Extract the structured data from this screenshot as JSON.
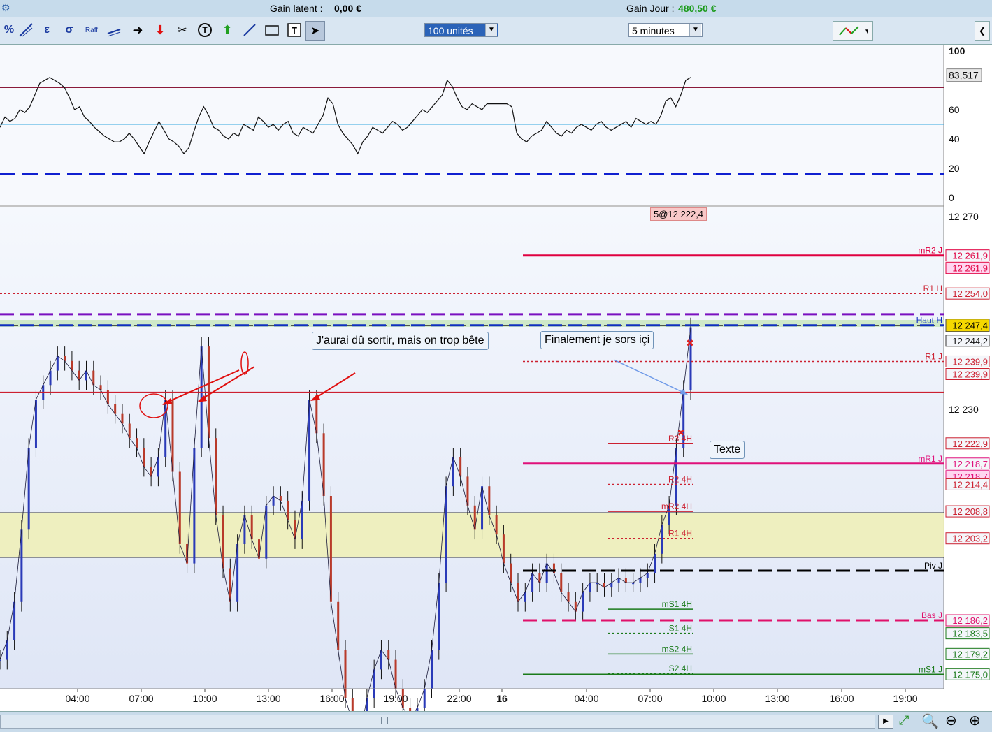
{
  "topbar": {
    "gain_latent_label": "Gain latent :",
    "gain_latent_value": "0,00 €",
    "gain_jour_label": "Gain Jour :",
    "gain_jour_value": "480,50 €",
    "gain_jour_color": "#1a9a1a"
  },
  "toolbar": {
    "quantity_select": "100 unités",
    "timeframe_select": "5 minutes",
    "tools": [
      "percent-icon",
      "trendline-icon",
      "epsilon-icon",
      "sigma-icon",
      "raff-icon",
      "channel-icon",
      "arrow-right-icon",
      "arrow-down-red-icon",
      "ruler-icon",
      "text-circle-icon",
      "arrow-up-green-icon",
      "diagonal-icon",
      "rectangle-icon",
      "text-box-icon",
      "cursor-icon"
    ],
    "raff_label": "Raff"
  },
  "annotations": {
    "mistake": "J'aurai dû sortir, mais on trop bête",
    "exit": "Finalement je sors içi",
    "texte": "Texte",
    "order_tag": "5@12 222,4"
  },
  "chart_data": [
    {
      "type": "line",
      "panel": "oscillator",
      "ylim": [
        0,
        100
      ],
      "yticks": [
        "100",
        "60",
        "40",
        "20",
        "0"
      ],
      "current_value": "83,517",
      "levels": [
        {
          "value": 75,
          "color": "#8a1a3a"
        },
        {
          "value": 50,
          "color": "#33a8e0"
        },
        {
          "value": 25,
          "color": "#cc3355"
        },
        {
          "value": 16,
          "color": "#1020d0",
          "style": "dashed"
        }
      ],
      "values": [
        48,
        55,
        52,
        54,
        60,
        58,
        62,
        70,
        78,
        80,
        82,
        80,
        78,
        75,
        68,
        60,
        62,
        55,
        52,
        48,
        45,
        42,
        40,
        38,
        38,
        40,
        44,
        40,
        35,
        30,
        38,
        45,
        52,
        46,
        40,
        38,
        35,
        30,
        34,
        45,
        55,
        62,
        56,
        48,
        46,
        42,
        40,
        44,
        42,
        50,
        48,
        46,
        55,
        52,
        48,
        50,
        46,
        50,
        52,
        44,
        42,
        48,
        46,
        44,
        50,
        56,
        68,
        64,
        50,
        44,
        40,
        36,
        30,
        38,
        42,
        48,
        46,
        44,
        48,
        52,
        50,
        46,
        48,
        52,
        56,
        60,
        58,
        62,
        66,
        70,
        80,
        76,
        68,
        62,
        60,
        64,
        62,
        60,
        64,
        64,
        64,
        64,
        64,
        62,
        44,
        40,
        38,
        42,
        44,
        46,
        52,
        48,
        44,
        42,
        46,
        44,
        48,
        50,
        48,
        46,
        50,
        52,
        48,
        46,
        48,
        50,
        52,
        48,
        54,
        52,
        50,
        52,
        50,
        56,
        66,
        68,
        62,
        70,
        80,
        82
      ]
    },
    {
      "type": "line",
      "panel": "price",
      "ylim": [
        12172,
        12272
      ],
      "yticks": [
        "12 270",
        "12 230"
      ],
      "xticks": [
        "04:00",
        "07:00",
        "10:00",
        "13:00",
        "16:00",
        "19:00",
        "22:00",
        "16",
        "04:00",
        "07:00",
        "10:00",
        "13:00",
        "16:00",
        "19:00"
      ],
      "values": [
        12178,
        12182,
        12190,
        12205,
        12222,
        12232,
        12235,
        12238,
        12241,
        12240,
        12238,
        12236,
        12238,
        12235,
        12234,
        12231,
        12229,
        12227,
        12224,
        12222,
        12218,
        12216,
        12220,
        12232,
        12217,
        12202,
        12198,
        12222,
        12243,
        12224,
        12208,
        12197,
        12190,
        12202,
        12208,
        12203,
        12199,
        12210,
        12212,
        12211,
        12207,
        12203,
        12211,
        12232,
        12225,
        12212,
        12190,
        12180,
        12170,
        12165,
        12162,
        12170,
        12176,
        12180,
        12178,
        12172,
        12168,
        12166,
        12168,
        12172,
        12180,
        12194,
        12214,
        12220,
        12216,
        12210,
        12205,
        12214,
        12208,
        12204,
        12198,
        12194,
        12190,
        12192,
        12196,
        12194,
        12198,
        12196,
        12192,
        12190,
        12188,
        12192,
        12194,
        12194,
        12193,
        12194,
        12195,
        12194,
        12194,
        12195,
        12196,
        12200,
        12206,
        12210,
        12222,
        12234,
        12247
      ],
      "hlines": [
        {
          "label": "mR2 J",
          "price": "12 261,9",
          "value": 12261.9,
          "color": "#e00040",
          "style": "solid",
          "start": "right-half",
          "extra_tag": "12 261,9",
          "extra_color": "#ffd6f0"
        },
        {
          "label": "R1 H",
          "price": "12 254,0",
          "value": 12254.0,
          "color": "#cc2030",
          "style": "dotted"
        },
        {
          "label": "",
          "price": "",
          "value": 12249.7,
          "color": "#7a10c0",
          "style": "dashed"
        },
        {
          "label": "Haut H",
          "price": "12 247,4",
          "value": 12247.4,
          "color": "#1030c0",
          "style": "dashed"
        },
        {
          "label": "R1 J",
          "price": "12 239,9",
          "value": 12239.9,
          "color": "#cc2030",
          "style": "dotted",
          "start": "right-half",
          "extra_tag": "12 239,9"
        },
        {
          "label": "",
          "price": "",
          "value": 12233.5,
          "color": "#cc2030",
          "style": "solid"
        },
        {
          "label": "R3 4H",
          "price": "12 222,9",
          "value": 12222.9,
          "color": "#cc2030",
          "style": "solid",
          "start": "4h"
        },
        {
          "label": "mR1 J",
          "price": "12 218,7",
          "value": 12218.7,
          "color": "#e0107a",
          "style": "solid",
          "start": "right-half",
          "extra_tag": "12 218,7",
          "extra_color": "#ffd6f0"
        },
        {
          "label": "R2 4H",
          "price": "12 214,4",
          "value": 12214.4,
          "color": "#cc2030",
          "style": "dotted",
          "start": "4h"
        },
        {
          "label": "mR2 4H",
          "price": "12 208,8",
          "value": 12208.8,
          "color": "#cc2030",
          "style": "solid",
          "start": "4h"
        },
        {
          "label": "R1 4H",
          "price": "12 203,2",
          "value": 12203.2,
          "color": "#cc2030",
          "style": "dotted",
          "start": "4h"
        },
        {
          "label": "Piv J",
          "price": "",
          "value": 12196.5,
          "color": "#000000",
          "style": "dashed",
          "start": "right-half"
        },
        {
          "label": "mS1 4H",
          "price": "",
          "value": 12188.5,
          "color": "#1a7a1a",
          "style": "solid",
          "start": "4h"
        },
        {
          "label": "Bas J",
          "price": "12 186,2",
          "value": 12186.2,
          "color": "#e0106a",
          "style": "dashed",
          "start": "right-half"
        },
        {
          "label": "S1 4H",
          "price": "12 183,5",
          "value": 12183.5,
          "color": "#1a7a1a",
          "style": "dotted",
          "start": "4h"
        },
        {
          "label": "mS2 4H",
          "price": "12 179,2",
          "value": 12179.2,
          "color": "#1a7a1a",
          "style": "solid",
          "start": "4h"
        },
        {
          "label": "S2 4H",
          "price": "",
          "value": 12175.2,
          "color": "#1a7a1a",
          "style": "dotted",
          "start": "4h"
        },
        {
          "label": "mS1 J",
          "price": "12 175,0",
          "value": 12175.0,
          "color": "#1a7a1a",
          "style": "solid",
          "start": "right-half"
        }
      ],
      "current_price": "12 247,4",
      "other_price_tags": [
        "12 244,2"
      ]
    }
  ]
}
